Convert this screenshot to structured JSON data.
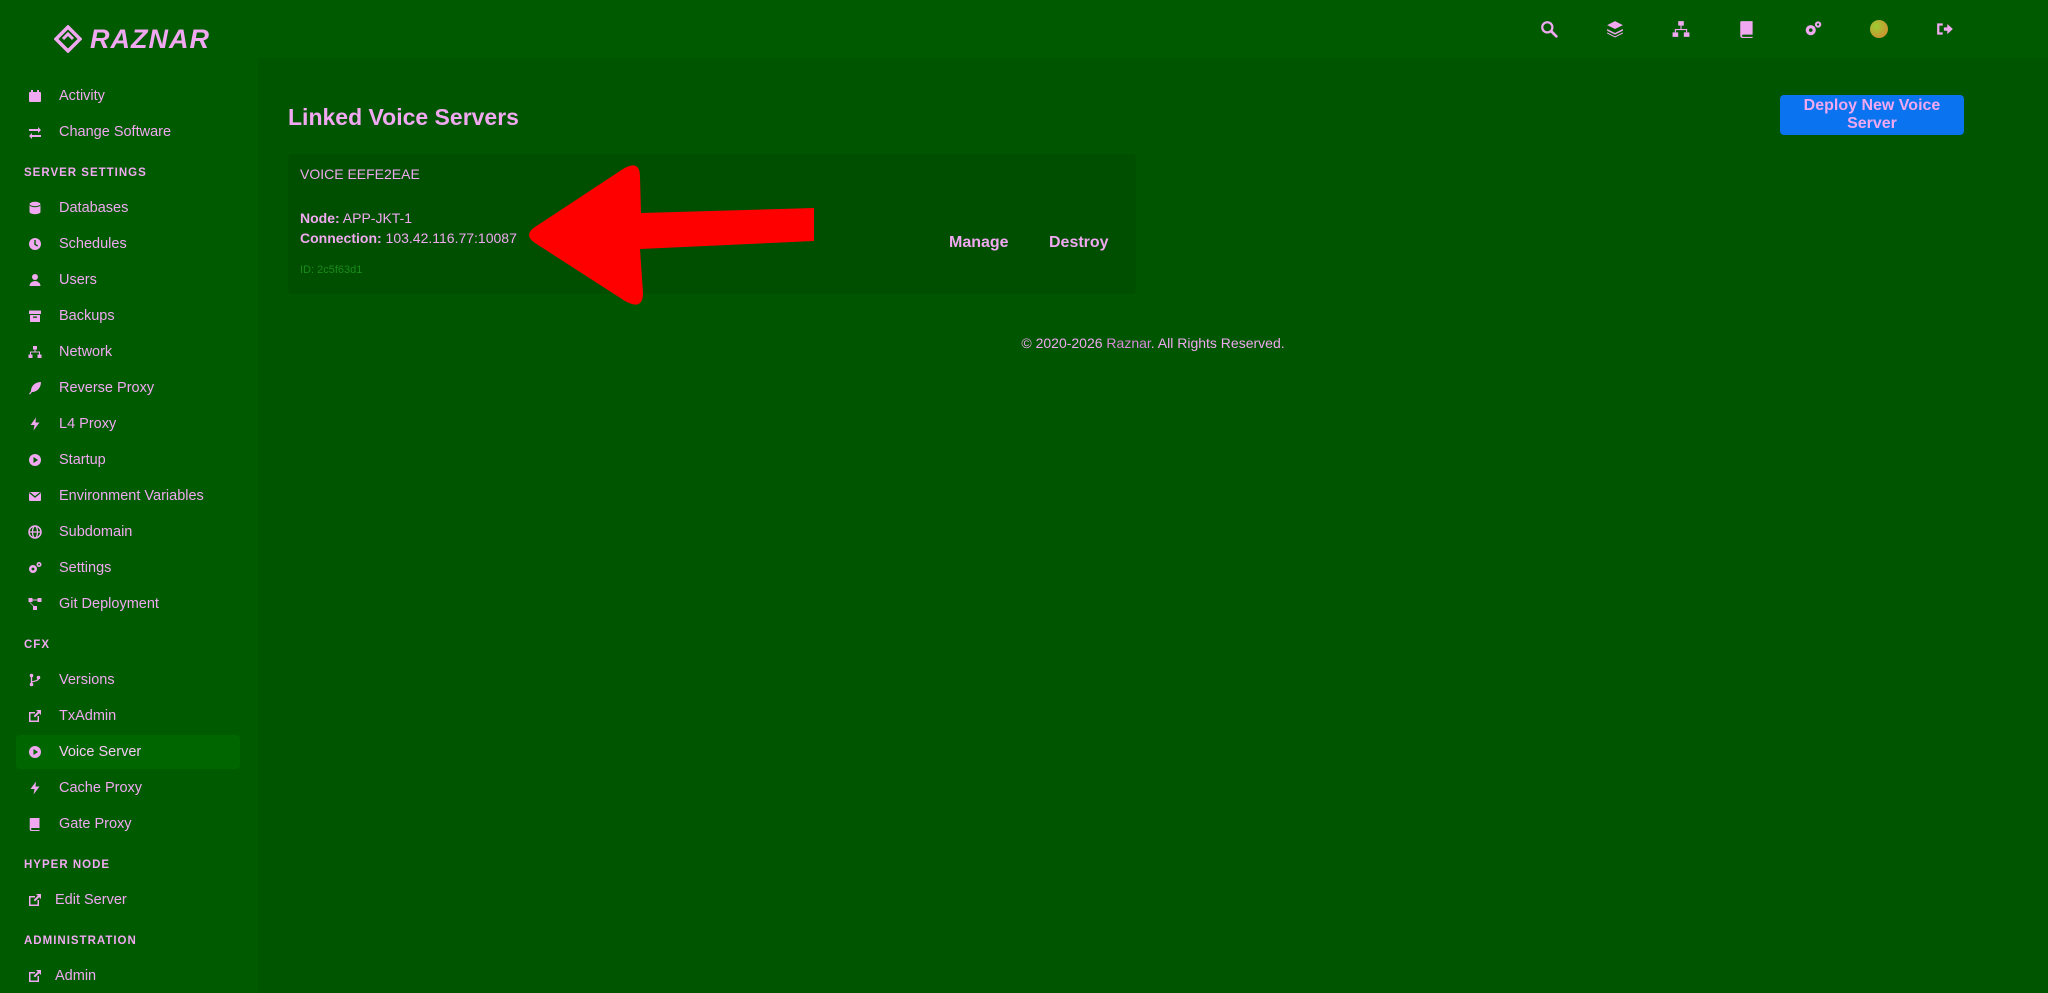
{
  "brand": {
    "name": "RAZNAR"
  },
  "topbar": {
    "icons": [
      "search-icon",
      "layers-icon",
      "network-icon",
      "book-icon",
      "cogs-icon",
      "avatar",
      "sign-out-icon"
    ]
  },
  "sidebar": {
    "items_top": [
      {
        "label": "Activity",
        "icon": "calendar-icon"
      },
      {
        "label": "Change Software",
        "icon": "exchange-icon"
      }
    ],
    "section_server_settings": "SERVER SETTINGS",
    "items_server": [
      {
        "label": "Databases",
        "icon": "database-icon"
      },
      {
        "label": "Schedules",
        "icon": "clock-icon"
      },
      {
        "label": "Users",
        "icon": "user-icon"
      },
      {
        "label": "Backups",
        "icon": "archive-icon"
      },
      {
        "label": "Network",
        "icon": "network-icon"
      },
      {
        "label": "Reverse Proxy",
        "icon": "feather-icon"
      },
      {
        "label": "L4 Proxy",
        "icon": "bolt-icon"
      },
      {
        "label": "Startup",
        "icon": "play-circle-icon"
      },
      {
        "label": "Environment Variables",
        "icon": "envelope-icon"
      },
      {
        "label": "Subdomain",
        "icon": "globe-icon"
      },
      {
        "label": "Settings",
        "icon": "cogs-icon"
      },
      {
        "label": "Git Deployment",
        "icon": "git-icon"
      }
    ],
    "section_cfx": "CFX",
    "items_cfx": [
      {
        "label": "Versions",
        "icon": "code-branch-icon"
      },
      {
        "label": "TxAdmin",
        "icon": "external-link-icon"
      },
      {
        "label": "Voice Server",
        "icon": "play-circle-icon"
      },
      {
        "label": "Cache Proxy",
        "icon": "bolt-icon"
      },
      {
        "label": "Gate Proxy",
        "icon": "book-icon"
      }
    ],
    "section_hyper_node": "HYPER NODE",
    "items_hyper": [
      {
        "label": "Edit Server",
        "icon": "external-link-icon"
      }
    ],
    "section_administration": "ADMINISTRATION",
    "items_admin": [
      {
        "label": "Admin",
        "icon": "external-link-icon"
      }
    ]
  },
  "main": {
    "title": "Linked Voice Servers",
    "deploy_label": "Deploy New Voice Server",
    "card": {
      "name": "VOICE EEFE2EAE",
      "node_label": "Node:",
      "node_value": "APP-JKT-1",
      "connection_label": "Connection:",
      "connection_value": "103.42.116.77:10087",
      "id_text": "ID: 2c5f63d1",
      "manage_label": "Manage",
      "destroy_label": "Destroy"
    },
    "footer": {
      "prefix": "© 2020-2026 ",
      "brand": "Raznar",
      "suffix": ".  All Rights Reserved."
    }
  },
  "colors": {
    "background": "#005a00",
    "text": "#f0a8f0",
    "primary_button": "#0a74f0",
    "annotation_arrow": "#ff0000"
  }
}
